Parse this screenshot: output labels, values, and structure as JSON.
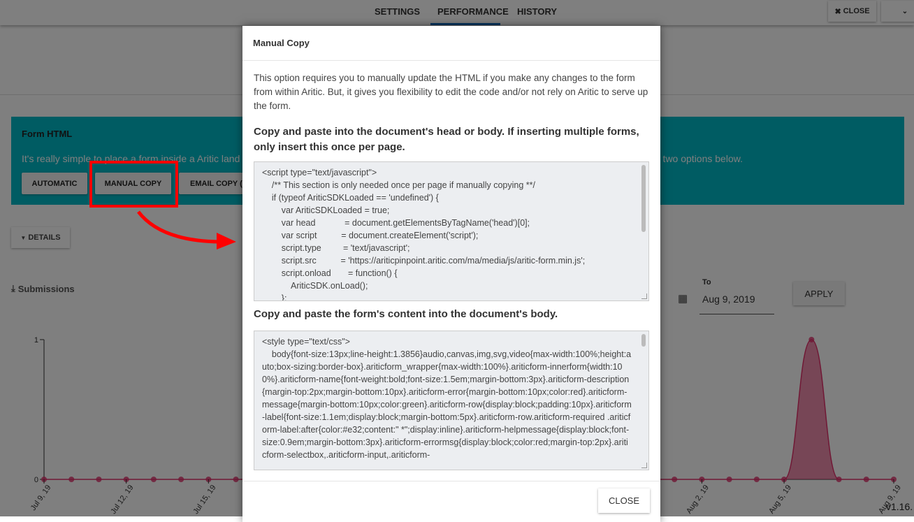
{
  "nav": {
    "tabs": [
      {
        "label": "SETTINGS"
      },
      {
        "label": "PERFORMANCE",
        "active": true
      },
      {
        "label": "HISTORY"
      }
    ],
    "close_label": "CLOSE"
  },
  "form_html": {
    "title": "Form HTML",
    "description_left": "It's really simple to place a form inside a Aritic land",
    "description_right": "r two options below.",
    "buttons": [
      "AUTOMATIC",
      "MANUAL COPY",
      "EMAIL COPY (E"
    ]
  },
  "details_label": "DETAILS",
  "submissions": {
    "title": "Submissions",
    "to_label": "To",
    "to_value": "Aug 9, 2019",
    "apply_label": "APPLY"
  },
  "version": "v1.16.",
  "chart_data": {
    "type": "area",
    "title": "",
    "xlabel": "",
    "ylabel": "",
    "ylim": [
      0,
      1
    ],
    "yticks": [
      "0",
      "1"
    ],
    "x": [
      "Jul 9",
      "Jul 10",
      "Jul 11",
      "Jul 12",
      "Jul 13",
      "Jul 14",
      "Jul 15",
      "Jul 16",
      "Jul 17",
      "Jul 18",
      "Jul 19",
      "Jul 20",
      "Jul 21",
      "Jul 22",
      "Jul 23",
      "Jul 24",
      "Jul 25",
      "Jul 26",
      "Jul 27",
      "Jul 28",
      "Jul 29",
      "Jul 30",
      "Jul 31",
      "Aug 1",
      "Aug 2",
      "Aug 3",
      "Aug 4",
      "Aug 5",
      "Aug 6",
      "Aug 7",
      "Aug 8",
      "Aug 9"
    ],
    "values": [
      0,
      0,
      0,
      0,
      0,
      0,
      0,
      0,
      0,
      0,
      0,
      0,
      0,
      0,
      0,
      0,
      0,
      0,
      0,
      0,
      0,
      0,
      0,
      0,
      0,
      0,
      0,
      0,
      1,
      0,
      0,
      0
    ],
    "visible_tick_labels": [
      {
        "index": 0,
        "label": "Jul 9, 19"
      },
      {
        "index": 3,
        "label": "Jul 12, 19"
      },
      {
        "index": 6,
        "label": "Jul 15, 19"
      },
      {
        "index": 24,
        "label": "Aug 2, 19"
      },
      {
        "index": 27,
        "label": "Aug 5, 19"
      },
      {
        "index": 31,
        "label": "Aug 9, 19"
      }
    ],
    "color": "#e0306a"
  },
  "modal": {
    "title": "Manual Copy",
    "intro": "This option requires you to manually update the HTML if you make any changes to the form from within Aritic. But, it gives you flexibility to edit the code and/or not rely on Aritic to serve up the form.",
    "head_heading": "Copy and paste into the document's head or body. If inserting multiple forms, only insert this once per page.",
    "head_code": [
      "<script type=\"text/javascript\">",
      "    /** This section is only needed once per page if manually copying **/",
      "    if (typeof AriticSDKLoaded == 'undefined') {",
      "        var AriticSDKLoaded = true;",
      "        var head            = document.getElementsByTagName('head')[0];",
      "        var script          = document.createElement('script');",
      "        script.type         = 'text/javascript';",
      "        script.src          = 'https://ariticpinpoint.aritic.com/ma/media/js/aritic-form.min.js';",
      "        script.onload       = function() {",
      "            AriticSDK.onLoad();",
      "        };"
    ],
    "body_heading": "Copy and paste the form's content into the document's body.",
    "body_code_first": "<style type=\"text/css\">",
    "body_code_rest": "    body{font-size:13px;line-height:1.3856}audio,canvas,img,svg,video{max-width:100%;height:auto;box-sizing:border-box}.ariticform_wrapper{max-width:100%}.ariticform-innerform{width:100%}.ariticform-name{font-weight:bold;font-size:1.5em;margin-bottom:3px}.ariticform-description{margin-top:2px;margin-bottom:10px}.ariticform-error{margin-bottom:10px;color:red}.ariticform-message{margin-bottom:10px;color:green}.ariticform-row{display:block;padding:10px}.ariticform-label{font-size:1.1em;display:block;margin-bottom:5px}.ariticform-row.ariticform-required .ariticform-label:after{color:#e32;content:\" *\";display:inline}.ariticform-helpmessage{display:block;font-size:0.9em;margin-bottom:3px}.ariticform-errormsg{display:block;color:red;margin-top:2px}.ariticform-selectbox,.ariticform-input,.ariticform-",
    "close_label": "CLOSE"
  },
  "annotation_color": "#ff0000"
}
